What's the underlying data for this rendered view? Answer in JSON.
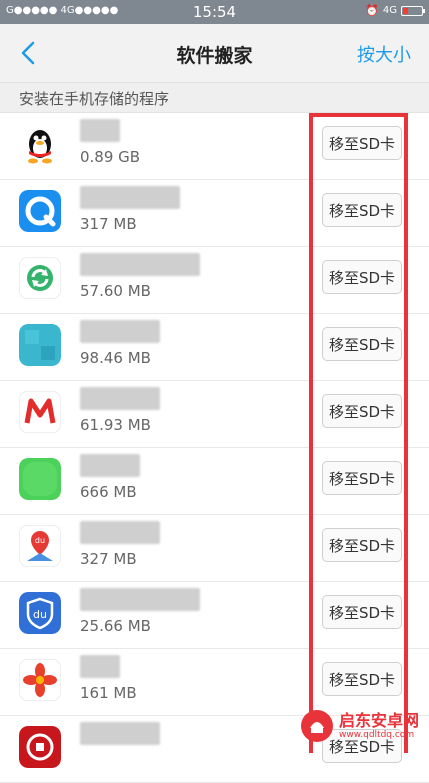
{
  "status_bar": {
    "carrier": "G●●●●● 4G●●●●●",
    "time": "15:54",
    "network": "4G"
  },
  "header": {
    "title": "软件搬家",
    "sort_label": "按大小"
  },
  "section_label": "安装在手机存储的程序",
  "apps": [
    {
      "size": "0.89 GB",
      "button": "移至SD卡",
      "icon": "qq-penguin-icon",
      "name_width": 40
    },
    {
      "size": "317 MB",
      "button": "移至SD卡",
      "icon": "qq-browser-icon",
      "name_width": 100
    },
    {
      "size": "57.60 MB",
      "button": "移至SD卡",
      "icon": "sync-icon",
      "name_width": 120
    },
    {
      "size": "98.46 MB",
      "button": "移至SD卡",
      "icon": "teal-app-icon",
      "name_width": 80
    },
    {
      "size": "61.93 MB",
      "button": "移至SD卡",
      "icon": "mail-m-icon",
      "name_width": 80
    },
    {
      "size": "666 MB",
      "button": "移至SD卡",
      "icon": "green-app-icon",
      "name_width": 60
    },
    {
      "size": "327 MB",
      "button": "移至SD卡",
      "icon": "baidu-map-icon",
      "name_width": 80
    },
    {
      "size": "25.66 MB",
      "button": "移至SD卡",
      "icon": "du-shield-icon",
      "name_width": 120
    },
    {
      "size": "161 MB",
      "button": "移至SD卡",
      "icon": "flower-app-icon",
      "name_width": 40
    },
    {
      "size": "",
      "button": "移至SD卡",
      "icon": "bank-icon",
      "name_width": 80
    }
  ],
  "watermark": {
    "text": "启东安卓网",
    "url": "www.qdltdq.com"
  }
}
